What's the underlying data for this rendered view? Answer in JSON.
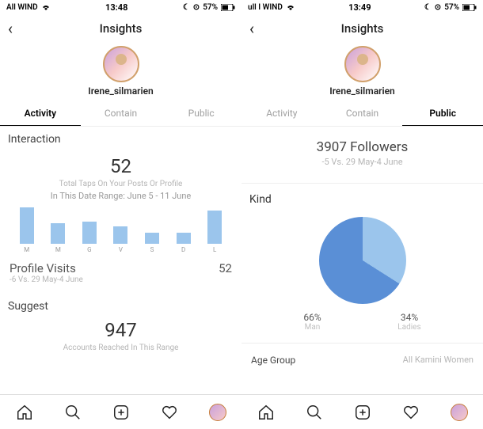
{
  "left": {
    "status": {
      "carrier": "All WIND",
      "time": "13:48",
      "battery": "57%"
    },
    "header": {
      "title": "Insights"
    },
    "profile": {
      "username": "Irene_silmarien"
    },
    "tabs": [
      "Activity",
      "Contain",
      "Public"
    ],
    "section": "Interaction",
    "taps": {
      "value": "52",
      "caption": "Total Taps On Your Posts Or Profile",
      "range": "In This Date Range: June 5 - 11 June"
    },
    "profile_visits": {
      "label": "Profile Visits",
      "value": "52",
      "sub": "-6 Vs. 29 May-4 June"
    },
    "suggest": {
      "label": "Suggest",
      "value": "947",
      "caption": "Accounts Reached In This Range"
    }
  },
  "right": {
    "status": {
      "carrier": "ull I WIND",
      "time": "13:49",
      "battery": "57%"
    },
    "header": {
      "title": "Insights"
    },
    "profile": {
      "username": "Irene_silmarien"
    },
    "tabs": [
      "Activity",
      "Contain",
      "Public"
    ],
    "followers": {
      "value": "3907 Followers",
      "sub": "-5 Vs. 29 May-4 June"
    },
    "kind": {
      "title": "Kind",
      "man_pct": "66%",
      "man_label": "Man",
      "ladies_pct": "34%",
      "ladies_label": "Ladies"
    },
    "age": {
      "label": "Age Group",
      "filter": "All Kamini Women"
    }
  },
  "chart_data": [
    {
      "type": "bar",
      "title": "Interaction",
      "categories": [
        "M",
        "M",
        "G",
        "V",
        "S",
        "D",
        "L"
      ],
      "values": [
        46,
        26,
        28,
        22,
        14,
        14,
        42
      ],
      "ylim": [
        0,
        50
      ],
      "color": "#9bc5ec"
    },
    {
      "type": "pie",
      "title": "Kind",
      "series": [
        {
          "name": "Man",
          "value": 66,
          "color": "#5a8fd6"
        },
        {
          "name": "Ladies",
          "value": 34,
          "color": "#9bc5ec"
        }
      ]
    }
  ]
}
